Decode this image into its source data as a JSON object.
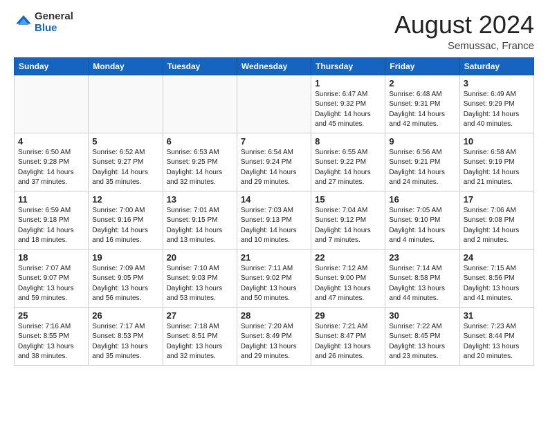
{
  "header": {
    "logo_general": "General",
    "logo_blue": "Blue",
    "month_year": "August 2024",
    "location": "Semussac, France"
  },
  "weekdays": [
    "Sunday",
    "Monday",
    "Tuesday",
    "Wednesday",
    "Thursday",
    "Friday",
    "Saturday"
  ],
  "weeks": [
    [
      {
        "day": null
      },
      {
        "day": null
      },
      {
        "day": null
      },
      {
        "day": null
      },
      {
        "day": 1,
        "sunrise": "6:47 AM",
        "sunset": "9:32 PM",
        "daylight": "14 hours and 45 minutes."
      },
      {
        "day": 2,
        "sunrise": "6:48 AM",
        "sunset": "9:31 PM",
        "daylight": "14 hours and 42 minutes."
      },
      {
        "day": 3,
        "sunrise": "6:49 AM",
        "sunset": "9:29 PM",
        "daylight": "14 hours and 40 minutes."
      }
    ],
    [
      {
        "day": 4,
        "sunrise": "6:50 AM",
        "sunset": "9:28 PM",
        "daylight": "14 hours and 37 minutes."
      },
      {
        "day": 5,
        "sunrise": "6:52 AM",
        "sunset": "9:27 PM",
        "daylight": "14 hours and 35 minutes."
      },
      {
        "day": 6,
        "sunrise": "6:53 AM",
        "sunset": "9:25 PM",
        "daylight": "14 hours and 32 minutes."
      },
      {
        "day": 7,
        "sunrise": "6:54 AM",
        "sunset": "9:24 PM",
        "daylight": "14 hours and 29 minutes."
      },
      {
        "day": 8,
        "sunrise": "6:55 AM",
        "sunset": "9:22 PM",
        "daylight": "14 hours and 27 minutes."
      },
      {
        "day": 9,
        "sunrise": "6:56 AM",
        "sunset": "9:21 PM",
        "daylight": "14 hours and 24 minutes."
      },
      {
        "day": 10,
        "sunrise": "6:58 AM",
        "sunset": "9:19 PM",
        "daylight": "14 hours and 21 minutes."
      }
    ],
    [
      {
        "day": 11,
        "sunrise": "6:59 AM",
        "sunset": "9:18 PM",
        "daylight": "14 hours and 18 minutes."
      },
      {
        "day": 12,
        "sunrise": "7:00 AM",
        "sunset": "9:16 PM",
        "daylight": "14 hours and 16 minutes."
      },
      {
        "day": 13,
        "sunrise": "7:01 AM",
        "sunset": "9:15 PM",
        "daylight": "14 hours and 13 minutes."
      },
      {
        "day": 14,
        "sunrise": "7:03 AM",
        "sunset": "9:13 PM",
        "daylight": "14 hours and 10 minutes."
      },
      {
        "day": 15,
        "sunrise": "7:04 AM",
        "sunset": "9:12 PM",
        "daylight": "14 hours and 7 minutes."
      },
      {
        "day": 16,
        "sunrise": "7:05 AM",
        "sunset": "9:10 PM",
        "daylight": "14 hours and 4 minutes."
      },
      {
        "day": 17,
        "sunrise": "7:06 AM",
        "sunset": "9:08 PM",
        "daylight": "14 hours and 2 minutes."
      }
    ],
    [
      {
        "day": 18,
        "sunrise": "7:07 AM",
        "sunset": "9:07 PM",
        "daylight": "13 hours and 59 minutes."
      },
      {
        "day": 19,
        "sunrise": "7:09 AM",
        "sunset": "9:05 PM",
        "daylight": "13 hours and 56 minutes."
      },
      {
        "day": 20,
        "sunrise": "7:10 AM",
        "sunset": "9:03 PM",
        "daylight": "13 hours and 53 minutes."
      },
      {
        "day": 21,
        "sunrise": "7:11 AM",
        "sunset": "9:02 PM",
        "daylight": "13 hours and 50 minutes."
      },
      {
        "day": 22,
        "sunrise": "7:12 AM",
        "sunset": "9:00 PM",
        "daylight": "13 hours and 47 minutes."
      },
      {
        "day": 23,
        "sunrise": "7:14 AM",
        "sunset": "8:58 PM",
        "daylight": "13 hours and 44 minutes."
      },
      {
        "day": 24,
        "sunrise": "7:15 AM",
        "sunset": "8:56 PM",
        "daylight": "13 hours and 41 minutes."
      }
    ],
    [
      {
        "day": 25,
        "sunrise": "7:16 AM",
        "sunset": "8:55 PM",
        "daylight": "13 hours and 38 minutes."
      },
      {
        "day": 26,
        "sunrise": "7:17 AM",
        "sunset": "8:53 PM",
        "daylight": "13 hours and 35 minutes."
      },
      {
        "day": 27,
        "sunrise": "7:18 AM",
        "sunset": "8:51 PM",
        "daylight": "13 hours and 32 minutes."
      },
      {
        "day": 28,
        "sunrise": "7:20 AM",
        "sunset": "8:49 PM",
        "daylight": "13 hours and 29 minutes."
      },
      {
        "day": 29,
        "sunrise": "7:21 AM",
        "sunset": "8:47 PM",
        "daylight": "13 hours and 26 minutes."
      },
      {
        "day": 30,
        "sunrise": "7:22 AM",
        "sunset": "8:45 PM",
        "daylight": "13 hours and 23 minutes."
      },
      {
        "day": 31,
        "sunrise": "7:23 AM",
        "sunset": "8:44 PM",
        "daylight": "13 hours and 20 minutes."
      }
    ]
  ],
  "labels": {
    "sunrise": "Sunrise:",
    "sunset": "Sunset:",
    "daylight": "Daylight:"
  }
}
